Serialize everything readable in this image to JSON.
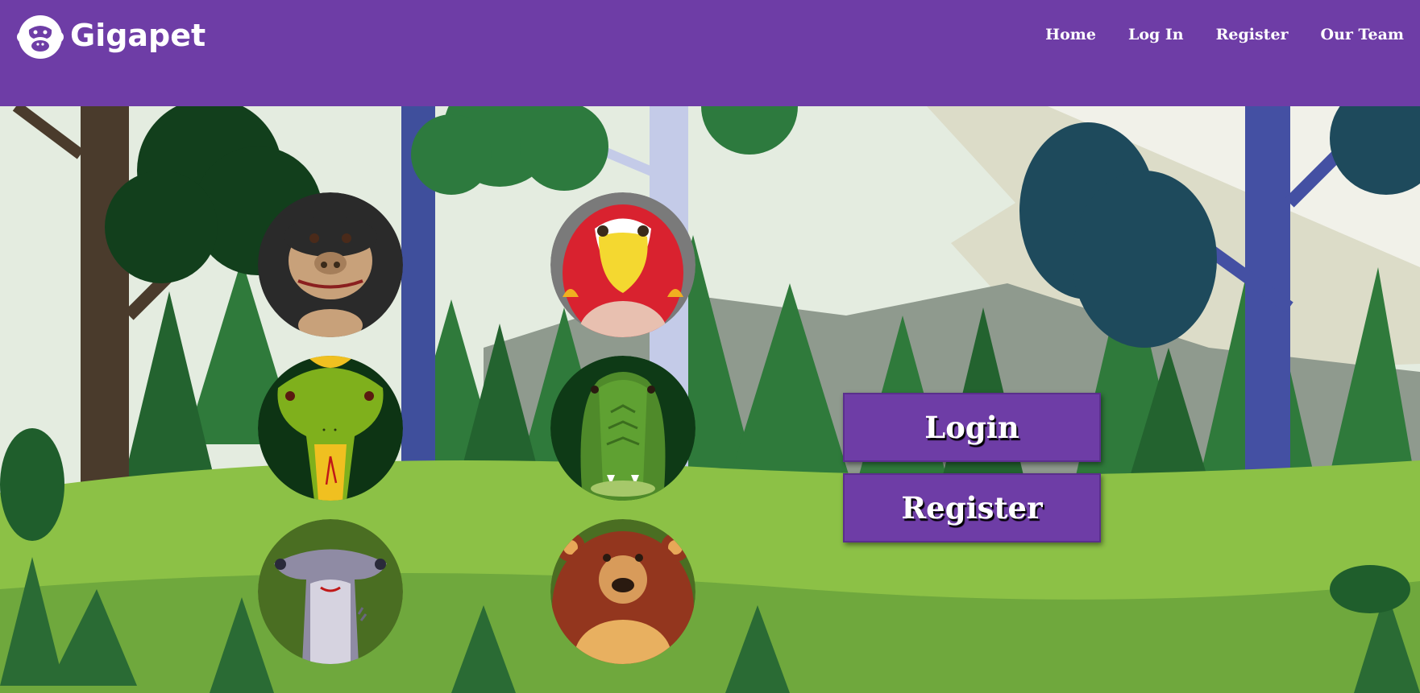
{
  "header": {
    "brand": "Gigapet",
    "logo_icon": "gorilla-head-icon",
    "nav": [
      "Home",
      "Log In",
      "Register",
      "Our Team"
    ]
  },
  "main": {
    "avatars": [
      {
        "name": "gorilla",
        "icon": "gorilla-icon"
      },
      {
        "name": "parrot",
        "icon": "parrot-icon"
      },
      {
        "name": "snake",
        "icon": "snake-icon"
      },
      {
        "name": "crocodile",
        "icon": "crocodile-icon"
      },
      {
        "name": "hammerhead shark",
        "icon": "shark-icon"
      },
      {
        "name": "bear",
        "icon": "bear-icon"
      }
    ],
    "login_label": "Login",
    "register_label": "Register"
  },
  "colors": {
    "header": "#6e3da6",
    "button": "#6e3da6"
  }
}
